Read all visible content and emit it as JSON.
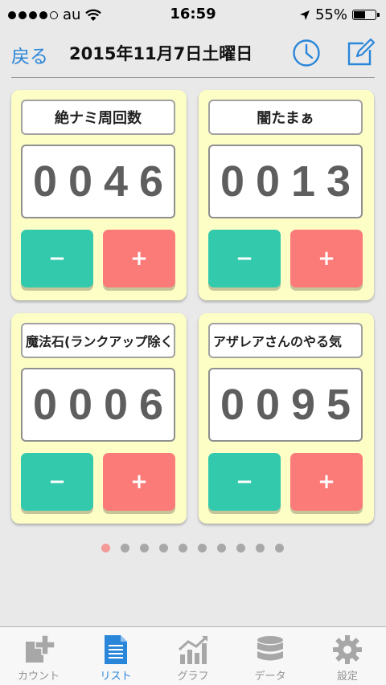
{
  "status": {
    "carrier": "au",
    "time": "16:59",
    "battery": "55%",
    "battery_level": 0.55
  },
  "nav": {
    "back_label": "戻る",
    "title": "2015年11月7日土曜日",
    "clock_icon": "clock-icon",
    "edit_icon": "compose-icon"
  },
  "counters": [
    {
      "label": "絶ナミ周回数",
      "value": "0046",
      "minus": "−",
      "plus": "+"
    },
    {
      "label": "闇たまぁ",
      "value": "0013",
      "minus": "−",
      "plus": "+"
    },
    {
      "label": "魔法石(ランクアップ除く",
      "value": "0006",
      "minus": "−",
      "plus": "+"
    },
    {
      "label": "アザレアさんのやる気",
      "value": "0095",
      "minus": "−",
      "plus": "+"
    }
  ],
  "pager": {
    "count": 10,
    "active": 1
  },
  "colors": {
    "accent": "#2a86d9",
    "card_bg": "#fdfdc6",
    "minus_button": "#33c9ad",
    "plus_button": "#fb7b79",
    "digits": "#5e5e5e"
  },
  "tabs": [
    {
      "label": "カウント",
      "icon": "add-counter-icon",
      "active": false
    },
    {
      "label": "リスト",
      "icon": "list-document-icon",
      "active": true
    },
    {
      "label": "グラフ",
      "icon": "graph-icon",
      "active": false
    },
    {
      "label": "データ",
      "icon": "database-icon",
      "active": false
    },
    {
      "label": "設定",
      "icon": "gear-icon",
      "active": false
    }
  ]
}
